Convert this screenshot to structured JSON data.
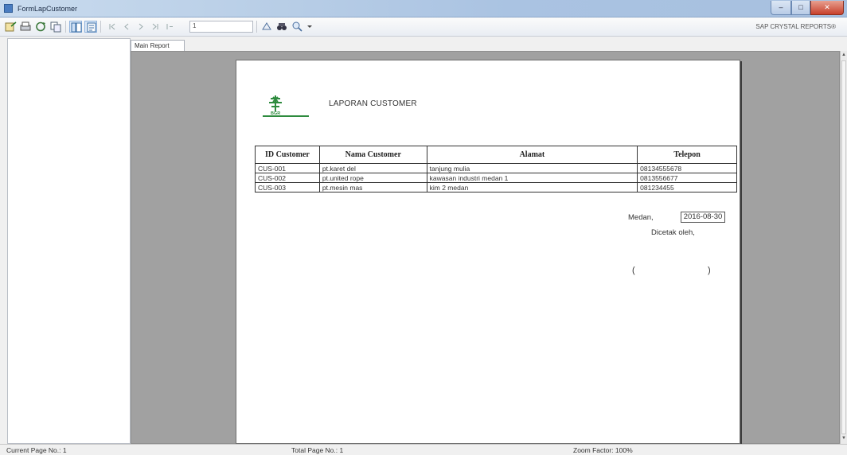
{
  "window": {
    "title": "FormLapCustomer"
  },
  "toolbar": {
    "page_value": "1",
    "sap_label": "SAP CRYSTAL REPORTS®"
  },
  "tabs": [
    {
      "label": "Main Report"
    }
  ],
  "report": {
    "title": "LAPORAN CUSTOMER",
    "logo_text": "BGR",
    "columns": [
      "ID Customer",
      "Nama Customer",
      "Alamat",
      "Telepon"
    ],
    "rows": [
      [
        "CUS-001",
        "pt.karet del",
        "tanjung mulia",
        "08134555678"
      ],
      [
        "CUS-002",
        "pt.united rope",
        "kawasan industri medan 1",
        "0813556677"
      ],
      [
        "CUS-003",
        "pt.mesin mas",
        "kim 2 medan",
        "081234455"
      ]
    ],
    "city": "Medan,",
    "date": "2016-08-30",
    "printed_by": "Dicetak oleh,",
    "sign_open": "(",
    "sign_close": ")"
  },
  "status": {
    "current_page": "Current Page No.: 1",
    "total_page": "Total Page No.: 1",
    "zoom": "Zoom Factor: 100%"
  },
  "colors": {
    "logo_green": "#2e8b3e",
    "viewer_bg": "#a1a1a1"
  }
}
